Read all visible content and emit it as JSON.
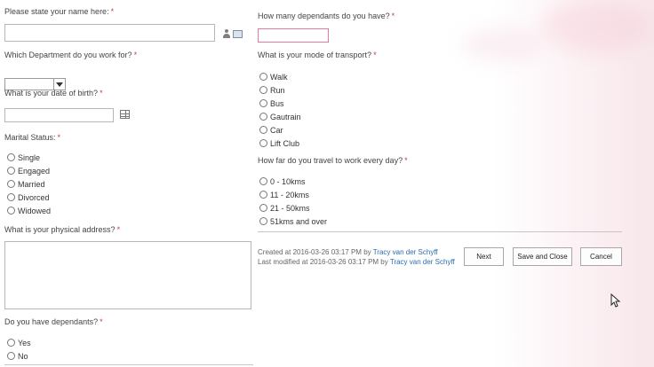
{
  "left": {
    "name": {
      "label": "Please state your name here:",
      "value": ""
    },
    "department": {
      "label": "Which Department do you work for?",
      "selected": ""
    },
    "dob": {
      "label": "What is your date of birth?",
      "value": ""
    },
    "marital": {
      "label": "Marital Status:",
      "options": [
        "Single",
        "Engaged",
        "Married",
        "Divorced",
        "Widowed"
      ]
    },
    "address": {
      "label": "What is your physical address?",
      "value": ""
    },
    "dependants": {
      "label": "Do you have dependants?",
      "options": [
        "Yes",
        "No"
      ]
    }
  },
  "right": {
    "dependants_count": {
      "label": "How many dependants do you have?",
      "value": ""
    },
    "transport": {
      "label": "What is your mode of transport?",
      "options": [
        "Walk",
        "Run",
        "Bus",
        "Gautrain",
        "Car",
        "Lift Club"
      ]
    },
    "distance": {
      "label": "How far do you travel to work every day?",
      "options": [
        "0 - 10kms",
        "11 - 20kms",
        "21 - 50kms",
        "51kms and over"
      ]
    }
  },
  "required_marker": "*",
  "meta": {
    "created_prefix": "Created at 2016-03-26 03:17 PM by",
    "created_user": "Tracy van der Schyff",
    "modified_prefix": "Last modified at 2016-03-26 03:17 PM by",
    "modified_user": "Tracy van der Schyff"
  },
  "buttons": {
    "next": "Next",
    "save_close": "Save and Close",
    "cancel": "Cancel"
  },
  "icons": {
    "people_picker": "person-icon",
    "address_book": "address-book-icon",
    "calendar": "calendar-icon",
    "cursor": "mouse-pointer-icon"
  },
  "colors": {
    "required": "#cc3b3b",
    "input_highlight": "#e57a9a",
    "link": "#2b6cb0"
  }
}
